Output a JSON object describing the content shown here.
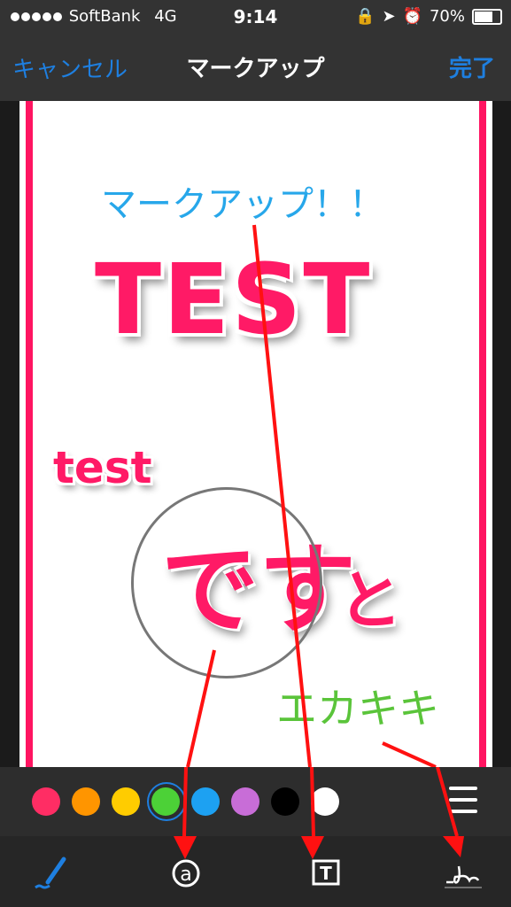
{
  "status_bar": {
    "carrier": "SoftBank",
    "network": "4G",
    "time": "9:14",
    "battery": "70%"
  },
  "nav_bar": {
    "cancel_label": "キャンセル",
    "title": "マークアップ",
    "done_label": "完了"
  },
  "canvas": {
    "text_blue": "マークアップ！！",
    "text_big": "TEST",
    "text_small": "test",
    "text_desu": "です",
    "text_to": "と",
    "text_green": "エカキキ"
  },
  "color_palette": {
    "colors": [
      "#ff2d64",
      "#ff9500",
      "#ffcc00",
      "#4cd137",
      "#1da1f2",
      "#c86dd7",
      "#000000",
      "#ffffff"
    ],
    "selected": "#4cd137"
  },
  "tools": [
    "pen-tool",
    "magnifier-tool",
    "text-tool",
    "signature-tool"
  ],
  "accent_color": "#1e7fe0"
}
